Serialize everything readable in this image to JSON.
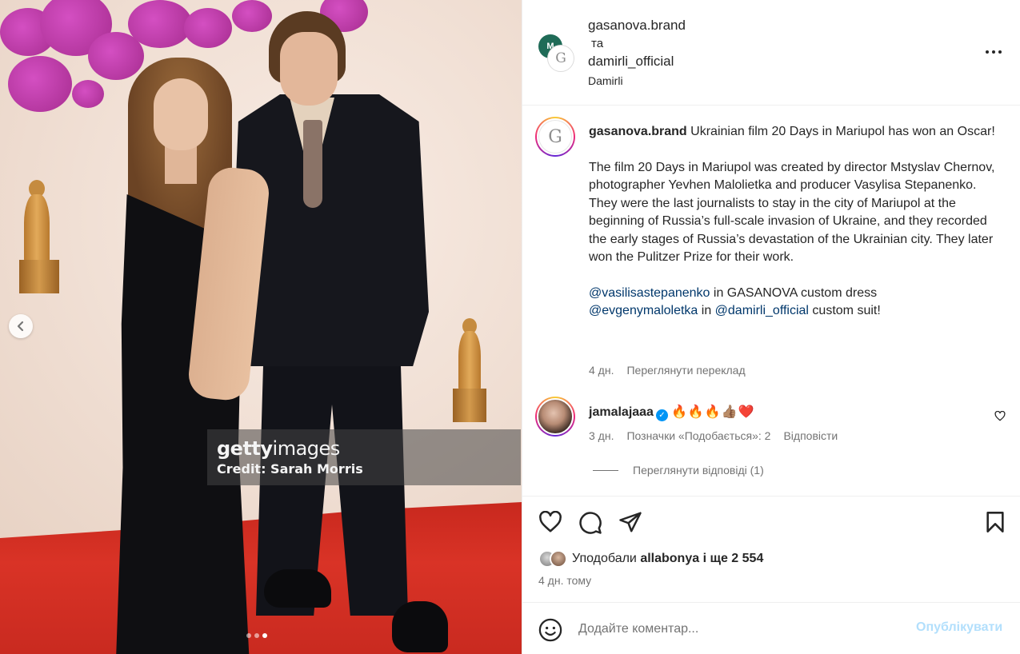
{
  "photo": {
    "watermark_brand_bold": "getty",
    "watermark_brand_rest": "images",
    "watermark_credit": "Credit: Sarah Morris",
    "slides_total": 3,
    "slide_active": 3
  },
  "header": {
    "user1": "gasanova.brand",
    "connector": "та",
    "user2": "damirli_official",
    "subtitle": "Damirli",
    "avatar2_letter": "G",
    "avatar1_letter": "M"
  },
  "caption": {
    "avatar_letter": "G",
    "user": "gasanova.brand",
    "line1": "Ukrainian film 20 Days in Mariupol has won an Oscar!",
    "paragraph": "The film 20 Days in Mariupol was created by director Mstyslav Chernov, photographer Yevhen Malolietka and producer Vasylisa Stepanenko. They were the last journalists to stay in the city of Mariupol at the beginning of Russia’s full-scale invasion of Ukraine, and they recorded the early stages of Russia’s devastation of the Ukrainian city. They later won the Pulitzer Prize for their work.",
    "mention1": "@vasilisastepanenko",
    "text1": " in GASANOVA custom dress",
    "mention2": "@evgenymaloletka",
    "text2": " in ",
    "mention3": "@damirli_official",
    "text3": " custom suit!",
    "time": "4 дн.",
    "translate": "Переглянути переклад"
  },
  "comment": {
    "user": "jamalajaaa",
    "verified_mark": "✓",
    "emojis": "🔥🔥🔥👍🏽❤️",
    "time": "3 дн.",
    "likes": "Позначки «Подобається»: 2",
    "reply": "Відповісти",
    "view_replies": "Переглянути відповіді (1)"
  },
  "likes": {
    "prefix": "Уподобали ",
    "user": "allabonya",
    "suffix": " і ще 2 554"
  },
  "post_time": "4 дн. тому",
  "add_comment": {
    "placeholder": "Додайте коментар...",
    "publish": "Опублікувати"
  },
  "icons": {
    "like": "heart-icon",
    "comment": "comment-icon",
    "share": "share-icon",
    "save": "bookmark-icon",
    "emoji": "emoji-icon",
    "more": "more-icon",
    "prev": "chevron-left-icon"
  },
  "colors": {
    "link": "#00376b",
    "muted": "#737373",
    "publish_disabled": "#b2dffc",
    "verified": "#0095f6"
  }
}
